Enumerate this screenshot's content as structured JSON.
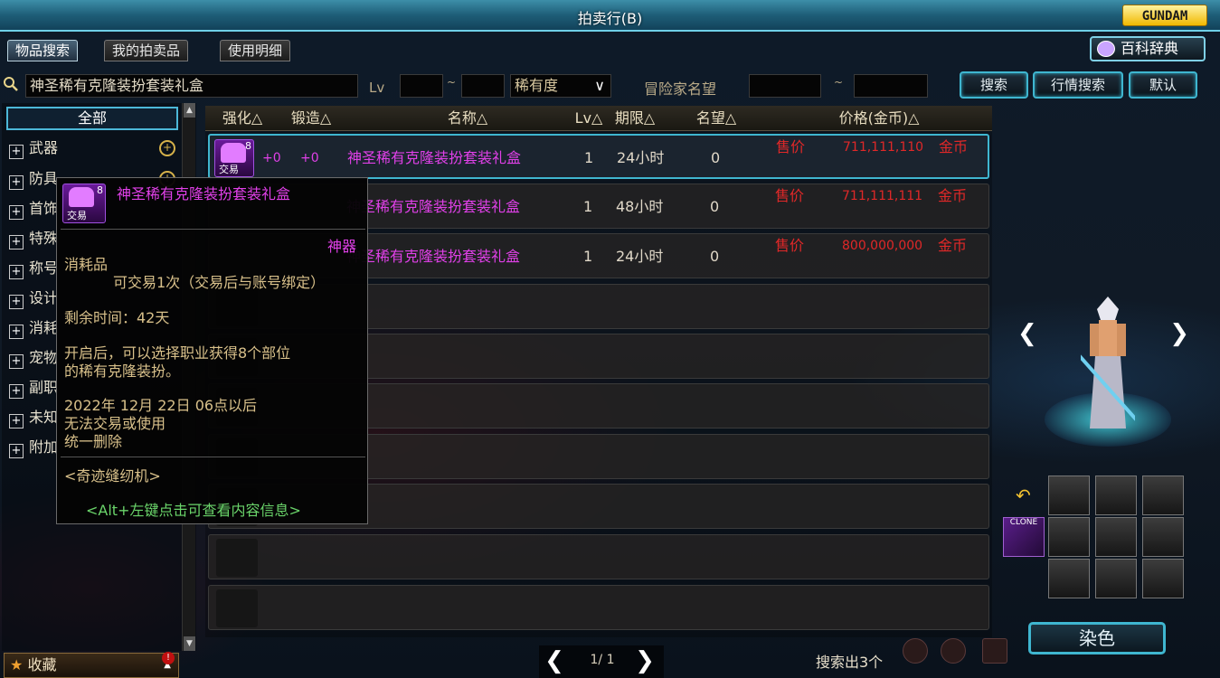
{
  "window": {
    "title": "拍卖行(B)",
    "logo": "GUNDAM"
  },
  "tabs": [
    {
      "label": "物品搜索",
      "active": true
    },
    {
      "label": "我的拍卖品",
      "active": false
    },
    {
      "label": "使用明细",
      "active": false
    }
  ],
  "baike_label": "百科辞典",
  "search": {
    "query": "神圣稀有克隆装扮套装礼盒",
    "lv_label": "Lv",
    "lv_sep": "~",
    "rarity": "稀有度",
    "fame_label": "冒险家名望",
    "fame_sep": "~",
    "search_btn": "搜索",
    "market_btn": "行情搜索",
    "default_btn": "默认"
  },
  "categories": {
    "all": "全部",
    "items": [
      {
        "label": "武器",
        "zoom": true
      },
      {
        "label": "防具",
        "zoom": true
      },
      {
        "label": "首饰",
        "zoom": false
      },
      {
        "label": "特殊",
        "zoom": false
      },
      {
        "label": "称号",
        "zoom": false
      },
      {
        "label": "设计",
        "zoom": false
      },
      {
        "label": "消耗",
        "zoom": false
      },
      {
        "label": "宠物",
        "zoom": false
      },
      {
        "label": "副职",
        "zoom": false
      },
      {
        "label": "未知",
        "zoom": false
      },
      {
        "label": "附加",
        "zoom": false
      }
    ],
    "favorites": "收藏"
  },
  "table": {
    "headers": {
      "enhance": "强化△",
      "forge": "锻造△",
      "name": "名称△",
      "lv": "Lv△",
      "period": "期限△",
      "fame": "名望△",
      "price": "价格(金币)△"
    },
    "rows": [
      {
        "enhance": "+0",
        "forge": "+0",
        "name": "神圣稀有克隆装扮套装礼盒",
        "lv": "1",
        "period": "24小时",
        "fame": "0",
        "sale": "售价",
        "price": "711,111,110",
        "currency": "金币",
        "icon_count": "8",
        "icon_trade": "交易"
      },
      {
        "enhance": "",
        "forge": "",
        "name": "神圣稀有克隆装扮套装礼盒",
        "lv": "1",
        "period": "48小时",
        "fame": "0",
        "sale": "售价",
        "price": "711,111,111",
        "currency": "金币",
        "icon_count": "",
        "icon_trade": ""
      },
      {
        "enhance": "",
        "forge": "",
        "name": "神圣稀有克隆装扮套装礼盒",
        "lv": "1",
        "period": "24小时",
        "fame": "0",
        "sale": "售价",
        "price": "800,000,000",
        "currency": "金币",
        "icon_count": "",
        "icon_trade": ""
      }
    ]
  },
  "pager": {
    "page": "1/ 1",
    "result": "搜索出3个"
  },
  "tooltip": {
    "name": "神圣稀有克隆装扮套装礼盒",
    "icon_count": "8",
    "icon_trade": "交易",
    "rarity": "神器",
    "type": "消耗品",
    "trade_info": "可交易1次（交易后与账号绑定）",
    "remaining": "剩余时间：42天",
    "desc_line1": "开启后，可以选择职业获得8个部位",
    "desc_line2": "的稀有克隆装扮。",
    "expire_line1": "2022年 12月 22日 06点以后",
    "expire_line2": "无法交易或使用",
    "expire_line3": "统一删除",
    "source": "<奇迹缝纫机>",
    "hint": "<Alt+左键点击可查看内容信息>"
  },
  "right_panel": {
    "dye_label": "染色",
    "clone_label": "CLONE"
  },
  "colors": {
    "name_purple": "#e040e8",
    "price_red": "#e02828",
    "accent_cyan": "#3fb6d0",
    "tooltip_gold": "#d8c08a",
    "hint_green": "#6ad46a"
  }
}
